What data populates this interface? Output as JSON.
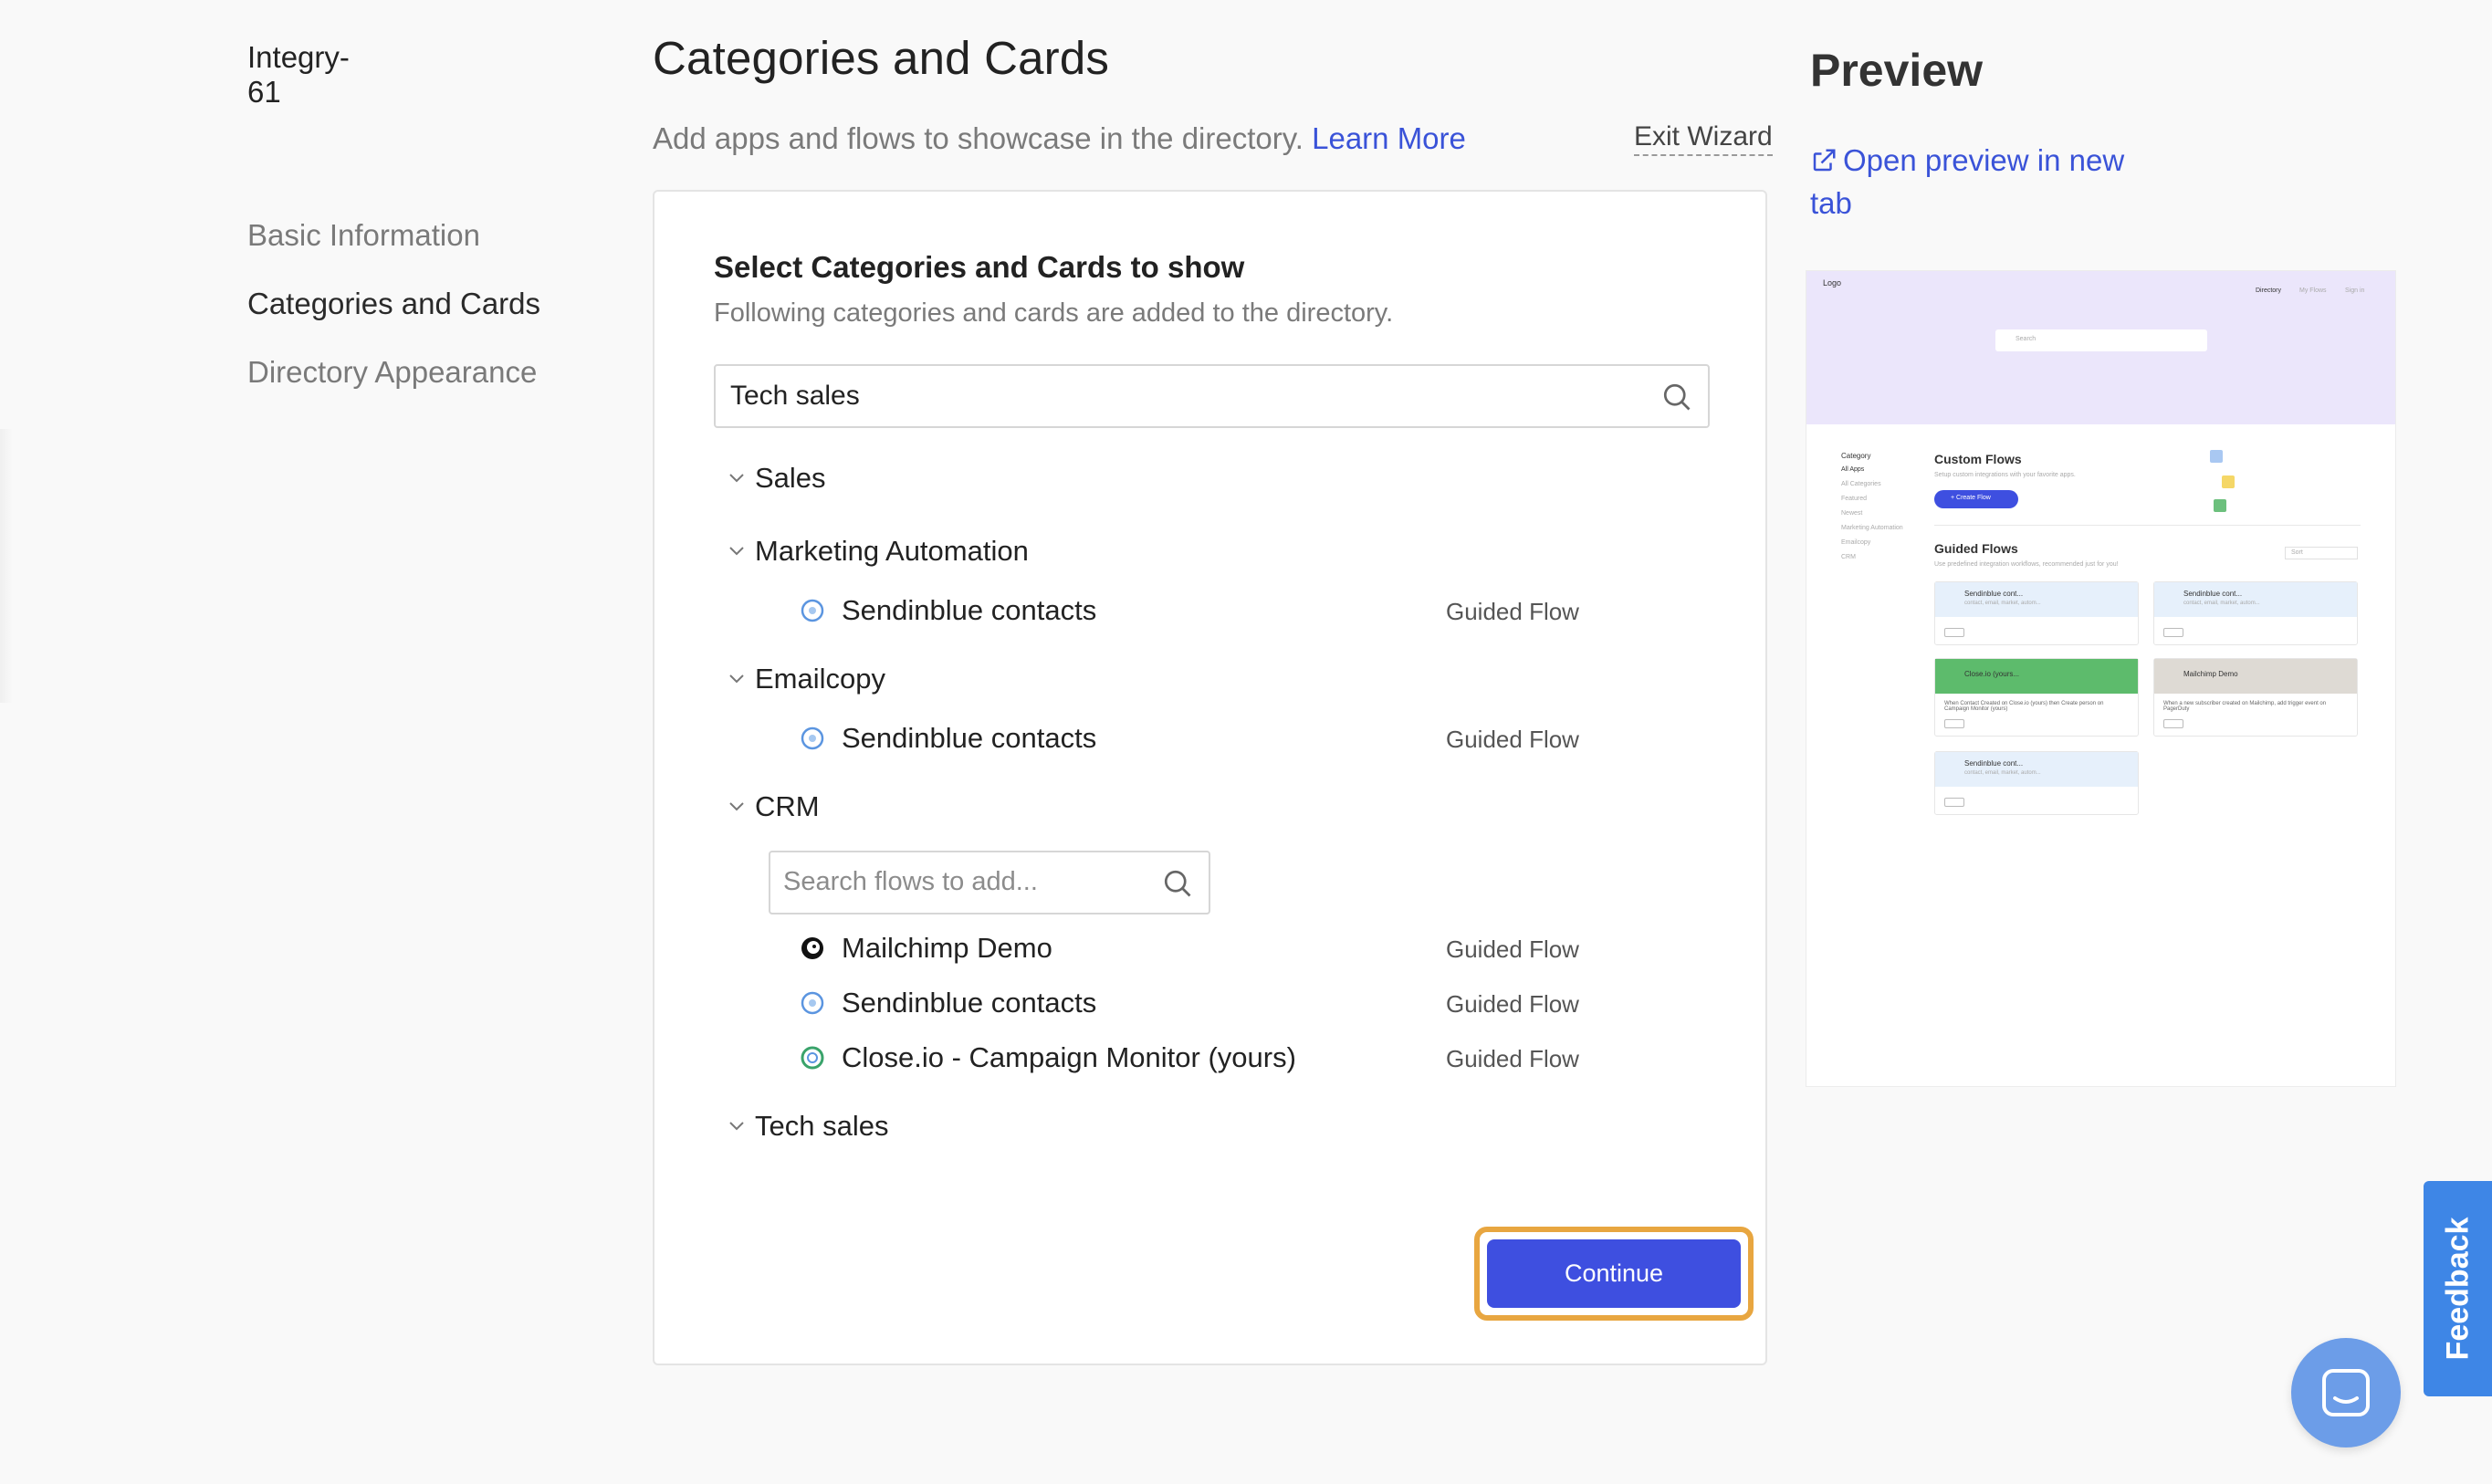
{
  "sidebar": {
    "brand": "Integry-61",
    "steps": [
      {
        "label": "Basic Information",
        "active": false
      },
      {
        "label": "Categories and Cards",
        "active": true
      },
      {
        "label": "Directory Appearance",
        "active": false
      }
    ]
  },
  "header": {
    "title": "Categories and Cards",
    "subtitle": "Add apps and flows to showcase in the directory.",
    "learn_more": "Learn More",
    "exit_wizard": "Exit Wizard"
  },
  "card": {
    "title": "Select Categories and Cards to show",
    "subtitle": "Following categories and cards are added to the directory.",
    "search_value": "Tech sales",
    "categories": [
      {
        "name": "Sales",
        "flows": []
      },
      {
        "name": "Marketing Automation",
        "flows": [
          {
            "name": "Sendinblue contacts",
            "type": "Guided Flow",
            "icon": "sendinblue-icon"
          }
        ]
      },
      {
        "name": "Emailcopy",
        "flows": [
          {
            "name": "Sendinblue contacts",
            "type": "Guided Flow",
            "icon": "sendinblue-icon"
          }
        ]
      },
      {
        "name": "CRM",
        "flows": [
          {
            "name": "Mailchimp Demo",
            "type": "Guided Flow",
            "icon": "mailchimp-icon"
          },
          {
            "name": "Sendinblue contacts",
            "type": "Guided Flow",
            "icon": "sendinblue-icon"
          },
          {
            "name": "Close.io - Campaign Monitor (yours)",
            "type": "Guided Flow",
            "icon": "closeio-icon"
          }
        ]
      },
      {
        "name": "Tech sales",
        "flows": []
      }
    ],
    "flow_search_placeholder": "Search flows to add...",
    "continue_label": "Continue"
  },
  "preview": {
    "title": "Preview",
    "open_link": "Open preview in new tab",
    "thumbnail": {
      "logo": "Logo",
      "nav": [
        "Directory",
        "My Flows",
        "Sign in"
      ],
      "search": "Search",
      "category_heading": "Category",
      "categories": [
        "All Apps",
        "All Categories",
        "Featured",
        "Newest",
        "Marketing Automation",
        "Emailcopy",
        "CRM"
      ],
      "custom_flows": "Custom Flows",
      "custom_flows_sub": "Setup custom integrations with your favorite apps.",
      "create_flow": "+ Create Flow",
      "guided_flows": "Guided Flows",
      "guided_flows_sub": "Use predefined integration workflows, recommended just for you!",
      "sort": "Sort",
      "cards": [
        {
          "title": "Sendinblue cont...",
          "sub": "contact, email, market, autom..."
        },
        {
          "title": "Sendinblue cont...",
          "sub": "contact, email, market, autom..."
        },
        {
          "title": "Close.io (yours...",
          "sub": "When Contact Created on Close.io (yours) then Create person on Campaign Monitor (yours)"
        },
        {
          "title": "Mailchimp Demo",
          "sub": "When a new subscriber created on Mailchimp, add trigger event on PagerDuty"
        },
        {
          "title": "Sendinblue cont...",
          "sub": "contact, email, market, autom..."
        }
      ],
      "setup": "Setup"
    }
  },
  "widgets": {
    "feedback": "Feedback"
  },
  "colors": {
    "accent": "#3e4fe0",
    "link": "#3a53d8",
    "highlight": "#e8a640",
    "feedback": "#3e86e6"
  }
}
